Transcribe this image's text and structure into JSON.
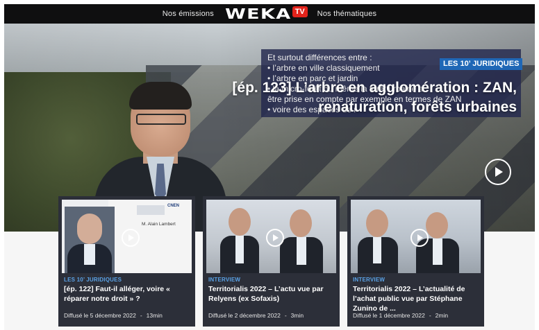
{
  "nav": {
    "left_link": "Nos émissions",
    "logo_word": "WEKA",
    "logo_badge": "TV",
    "right_link": "Nos thématiques"
  },
  "hero": {
    "info_lines": [
      "Et surtout différences entre :",
      "• l’arbre en ville classiquement",
      "• l’arbre en parc et jardin",
      "• la micro-forêt ou même la forêt urbaine a",
      "être prise en compte par exemple en termes de ZAN",
      "• voire des espaces de r"
    ],
    "badge": "LES 10’ JURIDIQUES",
    "title": "[ép. 123] L’arbre en agglomération : ZAN, renaturation, forêts urbaines",
    "play_icon": "play-circle-icon"
  },
  "cards": [
    {
      "category": "LES 10’ JURIDIQUES",
      "title": "[ép. 122] Faut-il alléger, voire « réparer notre droit » ?",
      "date": "Diffusé le 5 décembre 2022",
      "duration": "13min",
      "thumb_name": "M. Alain Lambert",
      "thumb_org": "CNEN"
    },
    {
      "category": "INTERVIEW",
      "title": "Territorialis 2022 – L’actu vue par Relyens (ex Sofaxis)",
      "date": "Diffusé le 2 décembre 2022",
      "duration": "3min"
    },
    {
      "category": "INTERVIEW",
      "title": "Territorialis 2022 – L’actualité de l’achat public vue par Stéphane Zunino de ...",
      "date": "Diffusé le 1 décembre 2022",
      "duration": "2min"
    }
  ],
  "meta_separator": "-",
  "colors": {
    "nav_bg": "#0f0f10",
    "logo_red": "#e3231b",
    "badge_blue": "#1f67b6",
    "card_bg": "#2c2f39",
    "category_blue": "#5aa2e6"
  }
}
